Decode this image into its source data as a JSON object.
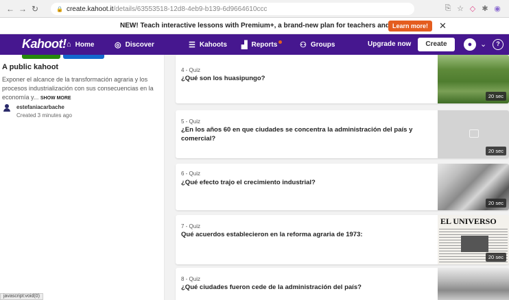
{
  "browser": {
    "url_host": "create.kahoot.it",
    "url_path": "/details/63553518-12d8-4eb9-b139-6d9664610ccc"
  },
  "promo": {
    "text": "NEW! Teach interactive lessons with Premium+, a brand-new plan for teachers and schools!",
    "learn_more": "Learn more!"
  },
  "nav": {
    "logo": "Kahoot!",
    "home": "Home",
    "discover": "Discover",
    "kahoots": "Kahoots",
    "reports": "Reports",
    "groups": "Groups",
    "upgrade": "Upgrade now",
    "create": "Create"
  },
  "kahoot": {
    "title": "A public kahoot",
    "description": "Exponer el alcance de la transformación agraria y los procesos industrialización con sus consecuencias en la economía y...",
    "show_more": "SHOW MORE",
    "author": "estefaniacarbache",
    "created": "Created 3 minutes ago"
  },
  "status_bar_url": "javascript:void(0)",
  "questions": [
    {
      "type": "4 - Quiz",
      "text": "¿Qué son los huasipungo?",
      "time": "20 sec"
    },
    {
      "type": "5 - Quiz",
      "text": "¿En los años 60 en que ciudades se concentra la administración del país y comercial?",
      "time": "20 sec"
    },
    {
      "type": "6 - Quiz",
      "text": "¿Qué efecto trajo el crecimiento industrial?",
      "time": "20 sec"
    },
    {
      "type": "7 - Quiz",
      "text": "Qué acuerdos establecieron en la reforma agraria de 1973:",
      "time": "20 sec"
    },
    {
      "type": "8 - Quiz",
      "text": "¿Qué ciudades fueron cede de la administración del país?",
      "time": ""
    }
  ],
  "newspaper_header": "EL UNIVERSO"
}
